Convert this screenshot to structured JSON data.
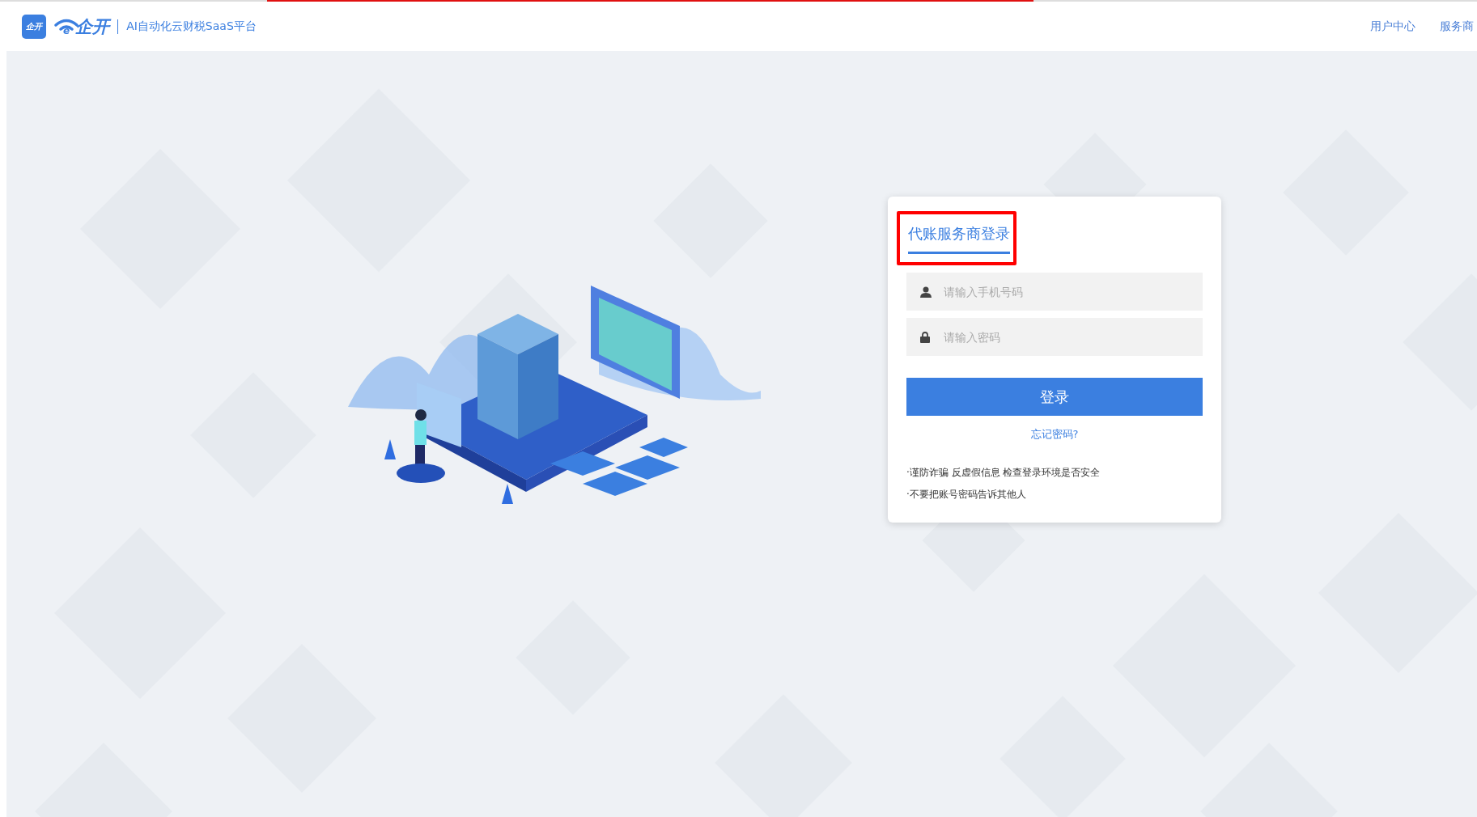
{
  "header": {
    "logo_badge": "企开",
    "logo_mark": "e",
    "logo_word": "企开",
    "tagline": "AI自动化云财税SaaS平台",
    "links": [
      "用户中心",
      "服务商"
    ]
  },
  "login_card": {
    "title": "代账服务商登录",
    "title_highlighted": true,
    "fields": [
      {
        "kind": "phone",
        "placeholder": "请输入手机号码"
      },
      {
        "kind": "password",
        "placeholder": "请输入密码"
      }
    ],
    "submit": "登录",
    "forgot": "忘记密码?",
    "notes": [
      "·谨防诈骗 反虚假信息 检查登录环境是否安全",
      "·不要把账号密码告诉其他人"
    ]
  }
}
